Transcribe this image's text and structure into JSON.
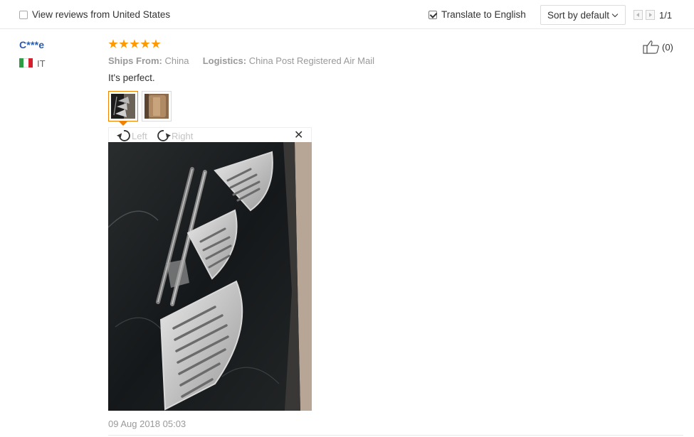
{
  "filter_bar": {
    "view_us_label": "View reviews from United States",
    "view_us_checked": false,
    "translate_label": "Translate to English",
    "translate_checked": true,
    "sort_value": "Sort by default",
    "page_indicator": "1/1"
  },
  "review": {
    "reviewer_name": "C***e",
    "country_code": "IT",
    "flag_colors": [
      "#2e9c45",
      "#ffffff",
      "#d3202e"
    ],
    "rating": 5,
    "ships_from_label": "Ships From:",
    "ships_from_value": "China",
    "logistics_label": "Logistics:",
    "logistics_value": "China Post Registered Air Mail",
    "text": "It's perfect.",
    "photo_viewer": {
      "rotate_left_label": "Left",
      "rotate_right_label": "Right",
      "close_icon": "close-icon"
    },
    "date": "09 Aug 2018 05:03",
    "helpful_count": "(0)"
  },
  "colors": {
    "star": "#ff9900",
    "reviewer_link": "#2a5ca8",
    "active_thumb": "#f08200",
    "muted_text": "#999999"
  }
}
